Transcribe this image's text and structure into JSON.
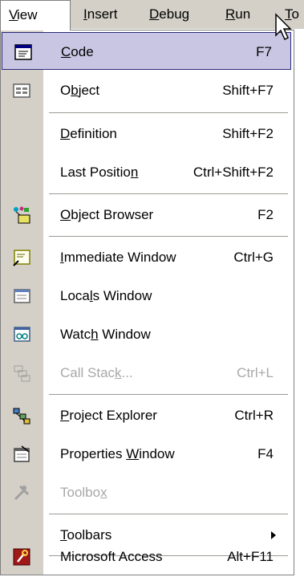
{
  "menubar": {
    "items": [
      {
        "label": "View",
        "ul": "V"
      },
      {
        "label": "Insert",
        "ul": "I"
      },
      {
        "label": "Debug",
        "ul": "D"
      },
      {
        "label": "Run",
        "ul": "R"
      },
      {
        "label": "To",
        "ul": "T"
      }
    ]
  },
  "view_menu": {
    "items": [
      {
        "icon": "code-window-icon",
        "pre": "",
        "ul": "C",
        "post": "ode",
        "shortcut": "F7",
        "state": "highlighted"
      },
      {
        "icon": "object-icon",
        "pre": "O",
        "ul": "b",
        "post": "ject",
        "shortcut": "Shift+F7",
        "state": "enabled"
      },
      {
        "icon": "",
        "pre": "",
        "ul": "D",
        "post": "efinition",
        "shortcut": "Shift+F2",
        "state": "enabled"
      },
      {
        "icon": "",
        "pre": "Last Positio",
        "ul": "n",
        "post": "",
        "shortcut": "Ctrl+Shift+F2",
        "state": "enabled"
      },
      {
        "icon": "object-browser-icon",
        "pre": "",
        "ul": "O",
        "post": "bject Browser",
        "shortcut": "F2",
        "state": "enabled"
      },
      {
        "icon": "immediate-window-icon",
        "pre": "",
        "ul": "I",
        "post": "mmediate Window",
        "shortcut": "Ctrl+G",
        "state": "enabled"
      },
      {
        "icon": "locals-window-icon",
        "pre": "Loca",
        "ul": "l",
        "post": "s Window",
        "shortcut": "",
        "state": "enabled"
      },
      {
        "icon": "watch-window-icon",
        "pre": "Watc",
        "ul": "h",
        "post": " Window",
        "shortcut": "",
        "state": "enabled"
      },
      {
        "icon": "call-stack-icon",
        "pre": "Call Stac",
        "ul": "k",
        "post": "...",
        "shortcut": "Ctrl+L",
        "state": "disabled"
      },
      {
        "icon": "project-explorer-icon",
        "pre": "",
        "ul": "P",
        "post": "roject Explorer",
        "shortcut": "Ctrl+R",
        "state": "enabled"
      },
      {
        "icon": "properties-window-icon",
        "pre": "Properties ",
        "ul": "W",
        "post": "indow",
        "shortcut": "F4",
        "state": "enabled"
      },
      {
        "icon": "toolbox-icon",
        "pre": "Toolbo",
        "ul": "x",
        "post": "",
        "shortcut": "",
        "state": "disabled"
      },
      {
        "icon": "",
        "pre": "",
        "ul": "T",
        "post": "oolbars",
        "shortcut": "",
        "state": "enabled"
      },
      {
        "icon": "microsoft-access-icon",
        "pre": "Microsoft Access",
        "ul": "",
        "post": "",
        "shortcut": "Alt+F11",
        "state": "enabled"
      }
    ]
  },
  "colors": {
    "menu_face": "#d4d0c8",
    "highlight_fill": "#c9c6e3",
    "highlight_border": "#2b2a7c",
    "disabled_text": "#a8a8a8"
  }
}
